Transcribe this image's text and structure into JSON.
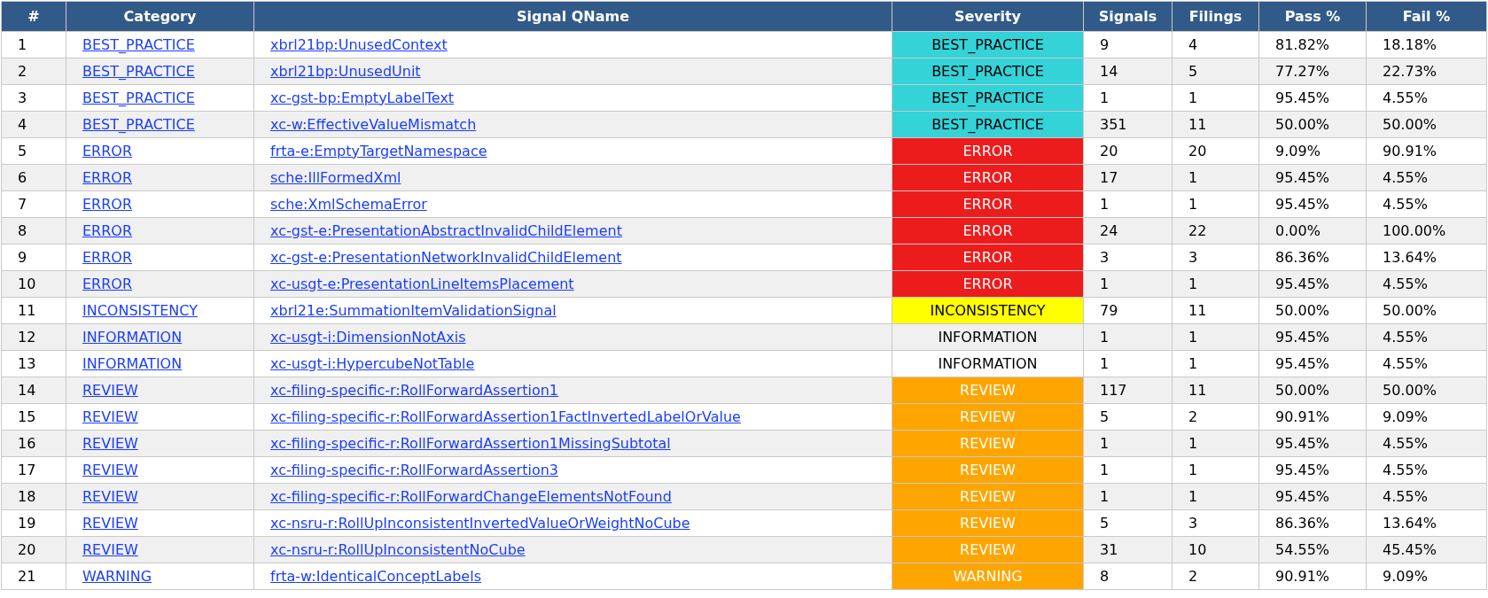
{
  "table": {
    "columns": [
      "#",
      "Category",
      "Signal QName",
      "Severity",
      "Signals",
      "Filings",
      "Pass %",
      "Fail %"
    ],
    "rows": [
      {
        "index": "1",
        "category": "BEST_PRACTICE",
        "qname": "xbrl21bp:UnusedContext",
        "severity": {
          "label": "BEST_PRACTICE",
          "kind": "dark",
          "color": "#33d3d8"
        },
        "signals": "9",
        "filings": "4",
        "pass": "81.82%",
        "fail": "18.18%"
      },
      {
        "index": "2",
        "category": "BEST_PRACTICE",
        "qname": "xbrl21bp:UnusedUnit",
        "severity": {
          "label": "BEST_PRACTICE",
          "kind": "dark",
          "color": "#33d3d8"
        },
        "signals": "14",
        "filings": "5",
        "pass": "77.27%",
        "fail": "22.73%"
      },
      {
        "index": "3",
        "category": "BEST_PRACTICE",
        "qname": "xc-gst-bp:EmptyLabelText",
        "severity": {
          "label": "BEST_PRACTICE",
          "kind": "dark",
          "color": "#33d3d8"
        },
        "signals": "1",
        "filings": "1",
        "pass": "95.45%",
        "fail": "4.55%"
      },
      {
        "index": "4",
        "category": "BEST_PRACTICE",
        "qname": "xc-w:EffectiveValueMismatch",
        "severity": {
          "label": "BEST_PRACTICE",
          "kind": "dark",
          "color": "#33d3d8"
        },
        "signals": "351",
        "filings": "11",
        "pass": "50.00%",
        "fail": "50.00%"
      },
      {
        "index": "5",
        "category": "ERROR",
        "qname": "frta-e:EmptyTargetNamespace",
        "severity": {
          "label": "ERROR",
          "kind": "light",
          "color": "#ed1c1c"
        },
        "signals": "20",
        "filings": "20",
        "pass": "9.09%",
        "fail": "90.91%"
      },
      {
        "index": "6",
        "category": "ERROR",
        "qname": "sche:IllFormedXml",
        "severity": {
          "label": "ERROR",
          "kind": "light",
          "color": "#ed1c1c"
        },
        "signals": "17",
        "filings": "1",
        "pass": "95.45%",
        "fail": "4.55%"
      },
      {
        "index": "7",
        "category": "ERROR",
        "qname": "sche:XmlSchemaError",
        "severity": {
          "label": "ERROR",
          "kind": "light",
          "color": "#ed1c1c"
        },
        "signals": "1",
        "filings": "1",
        "pass": "95.45%",
        "fail": "4.55%"
      },
      {
        "index": "8",
        "category": "ERROR",
        "qname": "xc-gst-e:PresentationAbstractInvalidChildElement",
        "severity": {
          "label": "ERROR",
          "kind": "light",
          "color": "#ed1c1c"
        },
        "signals": "24",
        "filings": "22",
        "pass": "0.00%",
        "fail": "100.00%"
      },
      {
        "index": "9",
        "category": "ERROR",
        "qname": "xc-gst-e:PresentationNetworkInvalidChildElement",
        "severity": {
          "label": "ERROR",
          "kind": "light",
          "color": "#ed1c1c"
        },
        "signals": "3",
        "filings": "3",
        "pass": "86.36%",
        "fail": "13.64%"
      },
      {
        "index": "10",
        "category": "ERROR",
        "qname": "xc-usgt-e:PresentationLineItemsPlacement",
        "severity": {
          "label": "ERROR",
          "kind": "light",
          "color": "#ed1c1c"
        },
        "signals": "1",
        "filings": "1",
        "pass": "95.45%",
        "fail": "4.55%"
      },
      {
        "index": "11",
        "category": "INCONSISTENCY",
        "qname": "xbrl21e:SummationItemValidationSignal",
        "severity": {
          "label": "INCONSISTENCY",
          "kind": "dark",
          "color": "#ffff00"
        },
        "signals": "79",
        "filings": "11",
        "pass": "50.00%",
        "fail": "50.00%"
      },
      {
        "index": "12",
        "category": "INFORMATION",
        "qname": "xc-usgt-i:DimensionNotAxis",
        "severity": {
          "label": "INFORMATION",
          "kind": "plain"
        },
        "signals": "1",
        "filings": "1",
        "pass": "95.45%",
        "fail": "4.55%"
      },
      {
        "index": "13",
        "category": "INFORMATION",
        "qname": "xc-usgt-i:HypercubeNotTable",
        "severity": {
          "label": "INFORMATION",
          "kind": "plain"
        },
        "signals": "1",
        "filings": "1",
        "pass": "95.45%",
        "fail": "4.55%"
      },
      {
        "index": "14",
        "category": "REVIEW",
        "qname": "xc-filing-specific-r:RollForwardAssertion1",
        "severity": {
          "label": "REVIEW",
          "kind": "light",
          "color": "#ffa500"
        },
        "signals": "117",
        "filings": "11",
        "pass": "50.00%",
        "fail": "50.00%"
      },
      {
        "index": "15",
        "category": "REVIEW",
        "qname": "xc-filing-specific-r:RollForwardAssertion1FactInvertedLabelOrValue",
        "severity": {
          "label": "REVIEW",
          "kind": "light",
          "color": "#ffa500"
        },
        "signals": "5",
        "filings": "2",
        "pass": "90.91%",
        "fail": "9.09%"
      },
      {
        "index": "16",
        "category": "REVIEW",
        "qname": "xc-filing-specific-r:RollForwardAssertion1MissingSubtotal",
        "severity": {
          "label": "REVIEW",
          "kind": "light",
          "color": "#ffa500"
        },
        "signals": "1",
        "filings": "1",
        "pass": "95.45%",
        "fail": "4.55%"
      },
      {
        "index": "17",
        "category": "REVIEW",
        "qname": "xc-filing-specific-r:RollForwardAssertion3",
        "severity": {
          "label": "REVIEW",
          "kind": "light",
          "color": "#ffa500"
        },
        "signals": "1",
        "filings": "1",
        "pass": "95.45%",
        "fail": "4.55%"
      },
      {
        "index": "18",
        "category": "REVIEW",
        "qname": "xc-filing-specific-r:RollForwardChangeElementsNotFound",
        "severity": {
          "label": "REVIEW",
          "kind": "light",
          "color": "#ffa500"
        },
        "signals": "1",
        "filings": "1",
        "pass": "95.45%",
        "fail": "4.55%"
      },
      {
        "index": "19",
        "category": "REVIEW",
        "qname": "xc-nsru-r:RollUpInconsistentInvertedValueOrWeightNoCube",
        "severity": {
          "label": "REVIEW",
          "kind": "light",
          "color": "#ffa500"
        },
        "signals": "5",
        "filings": "3",
        "pass": "86.36%",
        "fail": "13.64%"
      },
      {
        "index": "20",
        "category": "REVIEW",
        "qname": "xc-nsru-r:RollUpInconsistentNoCube",
        "severity": {
          "label": "REVIEW",
          "kind": "light",
          "color": "#ffa500"
        },
        "signals": "31",
        "filings": "10",
        "pass": "54.55%",
        "fail": "45.45%"
      },
      {
        "index": "21",
        "category": "WARNING",
        "qname": "frta-w:IdenticalConceptLabels",
        "severity": {
          "label": "WARNING",
          "kind": "light",
          "color": "#ffa500"
        },
        "signals": "8",
        "filings": "2",
        "pass": "90.91%",
        "fail": "9.09%"
      }
    ]
  }
}
